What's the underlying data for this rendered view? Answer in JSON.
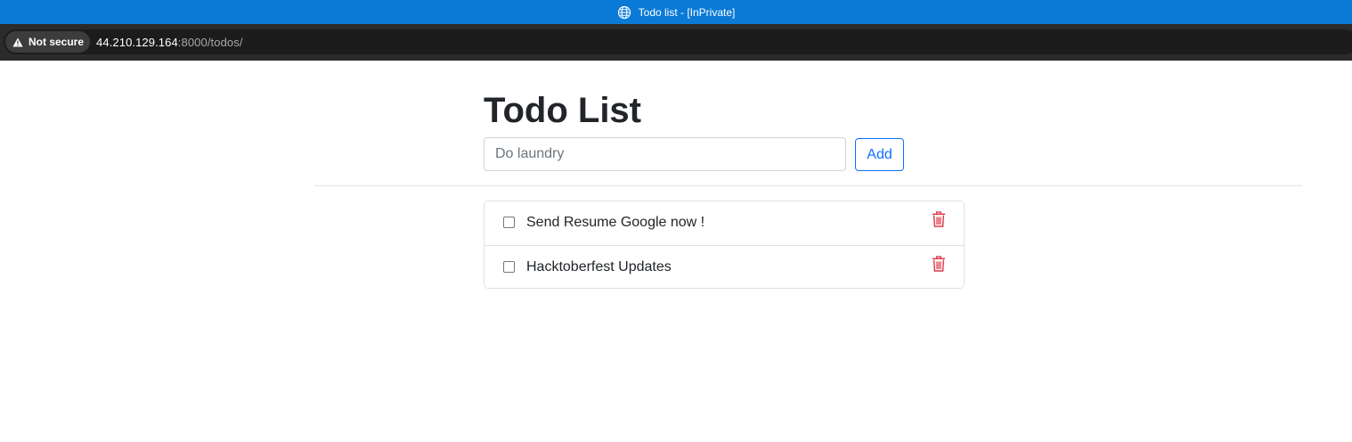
{
  "browser": {
    "window_title": "Todo list - [InPrivate]",
    "security_label": "Not secure",
    "url_host": "44.210.129.164",
    "url_rest": ":8000/todos/",
    "accent_color": "#0a7ad6"
  },
  "page": {
    "title": "Todo List",
    "input_placeholder": "Do laundry",
    "input_value": "",
    "add_label": "Add",
    "todos": [
      {
        "text": "Send Resume Google now !",
        "done": false
      },
      {
        "text": "Hacktoberfest Updates",
        "done": false
      }
    ],
    "delete_icon": "trash-icon",
    "delete_color": "#dc3545",
    "button_color": "#0d6efd"
  }
}
